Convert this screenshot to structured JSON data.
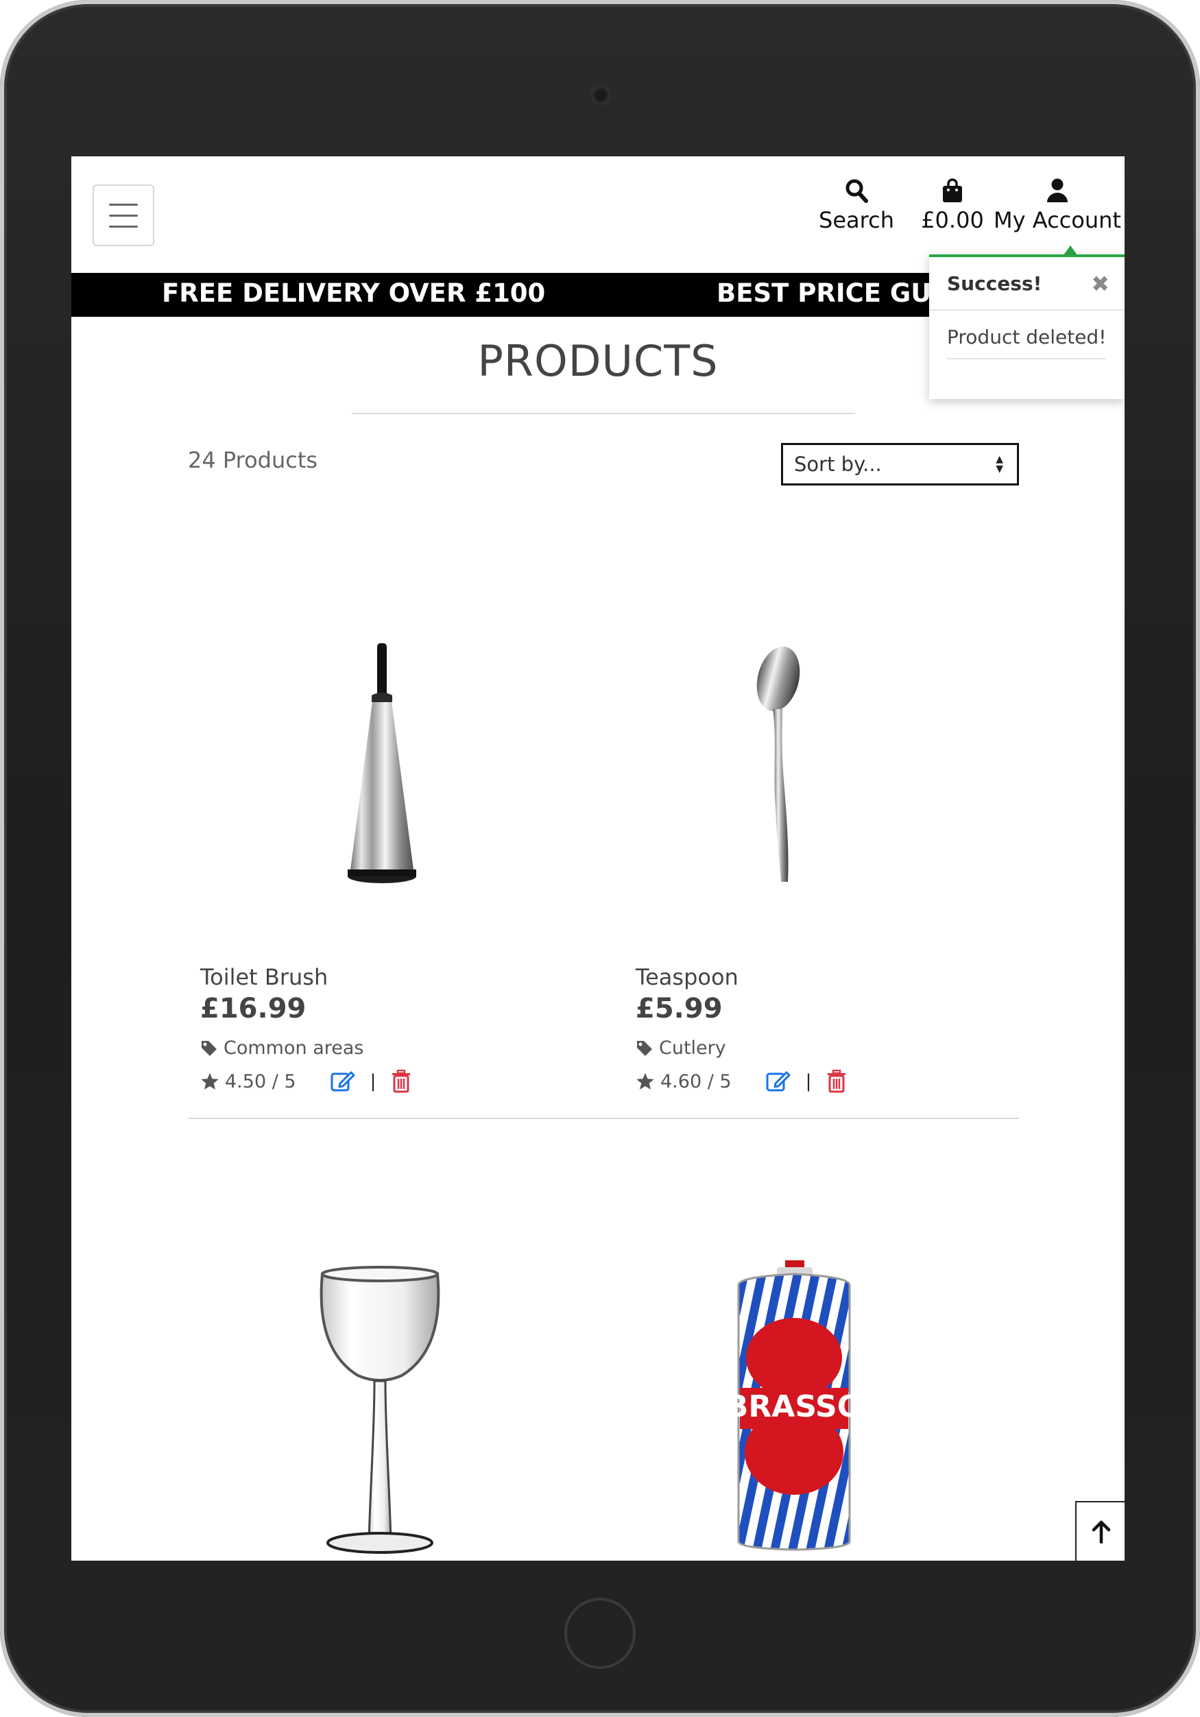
{
  "header": {
    "menu_icon": "hamburger-icon",
    "search": {
      "label": "Search",
      "icon": "search-icon"
    },
    "bag": {
      "label": "£0.00",
      "icon": "shopping-bag-icon"
    },
    "account": {
      "label": "My Account",
      "icon": "user-icon"
    }
  },
  "banner": {
    "messages": [
      "FREE DELIVERY OVER £100",
      "BEST PRICE GUA"
    ]
  },
  "toast": {
    "title": "Success!",
    "message": "Product deleted!",
    "close_icon": "close-icon",
    "accent": "#28a745"
  },
  "main": {
    "title": "PRODUCTS",
    "count_label": "24 Products",
    "sort": {
      "selected": "Sort by..."
    },
    "products": [
      {
        "name": "Toilet Brush",
        "price": "£16.99",
        "category": "Common areas",
        "rating": "4.50 / 5",
        "image": "toilet-brush"
      },
      {
        "name": "Teaspoon",
        "price": "£5.99",
        "category": "Cutlery",
        "rating": "4.60 / 5",
        "image": "teaspoon"
      },
      {
        "name": "",
        "price": "",
        "category": "",
        "rating": "",
        "image": "wine-glass"
      },
      {
        "name": "",
        "price": "",
        "category": "",
        "rating": "",
        "image": "brasso-tin",
        "label": "BRASSO"
      }
    ]
  },
  "colors": {
    "edit_icon": "#1a73e8",
    "delete_icon": "#dc3545",
    "banner_bg": "#000000",
    "text": "#444444"
  },
  "back_to_top": {
    "icon": "arrow-up-icon"
  }
}
